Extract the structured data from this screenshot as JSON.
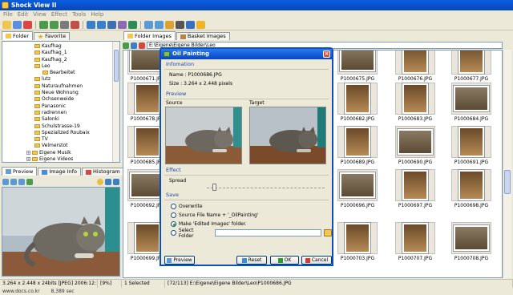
{
  "window": {
    "title": "Shock View II"
  },
  "menu": [
    "File",
    "Edit",
    "View",
    "Effect",
    "Tools",
    "Help"
  ],
  "left_tabs": {
    "folder": "Folder",
    "favorite": "Favorite"
  },
  "right_tabs": {
    "folder_images": "Folder Images",
    "basket_images": "Basket Images"
  },
  "path_field": "E:\\Eigene\\Eigene Bilder\\Leo",
  "tree": [
    {
      "label": "Kaufhag",
      "indent": 4
    },
    {
      "label": "Kaufhag_1",
      "indent": 4
    },
    {
      "label": "Kaufhag_2",
      "indent": 4
    },
    {
      "label": "Leo",
      "indent": 4,
      "expanded": true
    },
    {
      "label": "Bearbeitet",
      "indent": 5
    },
    {
      "label": "lutz",
      "indent": 4
    },
    {
      "label": "Naturaufnahmen",
      "indent": 4
    },
    {
      "label": "Neue Wohnung",
      "indent": 4
    },
    {
      "label": "Ochsenweide",
      "indent": 4
    },
    {
      "label": "Panasonic",
      "indent": 4
    },
    {
      "label": "radrennen",
      "indent": 4
    },
    {
      "label": "Salonki",
      "indent": 4
    },
    {
      "label": "Schulstrasse-19",
      "indent": 4
    },
    {
      "label": "Spezialized Roubaix",
      "indent": 4
    },
    {
      "label": "TV",
      "indent": 4
    },
    {
      "label": "Velmerstot",
      "indent": 4
    },
    {
      "label": "Eigene Musik",
      "indent": 3
    },
    {
      "label": "Eigene Videos",
      "indent": 3
    }
  ],
  "preview_tabs": {
    "preview": "Preview",
    "image_info": "Image Info",
    "histogram": "Histogram"
  },
  "grid": {
    "rows": [
      [
        "P1000671.JPG",
        "",
        "",
        "P1000675.JPG",
        "P1000676.JPG",
        "P1000677.JPG"
      ],
      [
        "P1000678.JPG",
        "",
        "",
        "P1000682.JPG",
        "P1000683.JPG",
        "P1000684.JPG"
      ],
      [
        "P1000685.JPG",
        "",
        "",
        "P1000689.JPG",
        "P1000690.JPG",
        "P1000691.JPG"
      ],
      [
        "P1000692.JPG",
        "",
        "",
        "P1000696.JPG",
        "P1000697.JPG",
        "P1000698.JPG"
      ],
      [
        "P1000699.JPG",
        "",
        "",
        "P1000703.JPG",
        "P1000707.JPG",
        "P1000708.JPG"
      ]
    ]
  },
  "dialog": {
    "title": "Oil Painting",
    "information_label": "Infomation",
    "name_line": "Name : P1000686.JPG",
    "size_line": "Size : 3.264 x 2.448 pixels",
    "preview_label": "Preview",
    "source_label": "Source",
    "target_label": "Target",
    "effect_label": "Effect",
    "spread_label": "Spread",
    "save_label": "Save",
    "options": [
      {
        "label": "Overwrite",
        "selected": false
      },
      {
        "label": "Source File Name + '_OilPainting'",
        "selected": false
      },
      {
        "label": "Make 'Edited Images' folder.",
        "selected": true
      },
      {
        "label": "Select Folder",
        "selected": false
      }
    ],
    "buttons": {
      "preview": "Preview",
      "reset": "Reset",
      "ok": "OK",
      "cancel": "Cancel"
    }
  },
  "status": {
    "image_info": "3.264 x 2.448 x 24bits [JPEG] 2006:12:14 20:1...",
    "zoom": "[9%]",
    "selected": "1 Selected",
    "position": "[72/113] E:\\Eigene\\Eigene Bilder\\Leo\\P1000686.JPG"
  },
  "footer": {
    "site": "www.docs.co.kr",
    "time": "8,389 sec"
  }
}
